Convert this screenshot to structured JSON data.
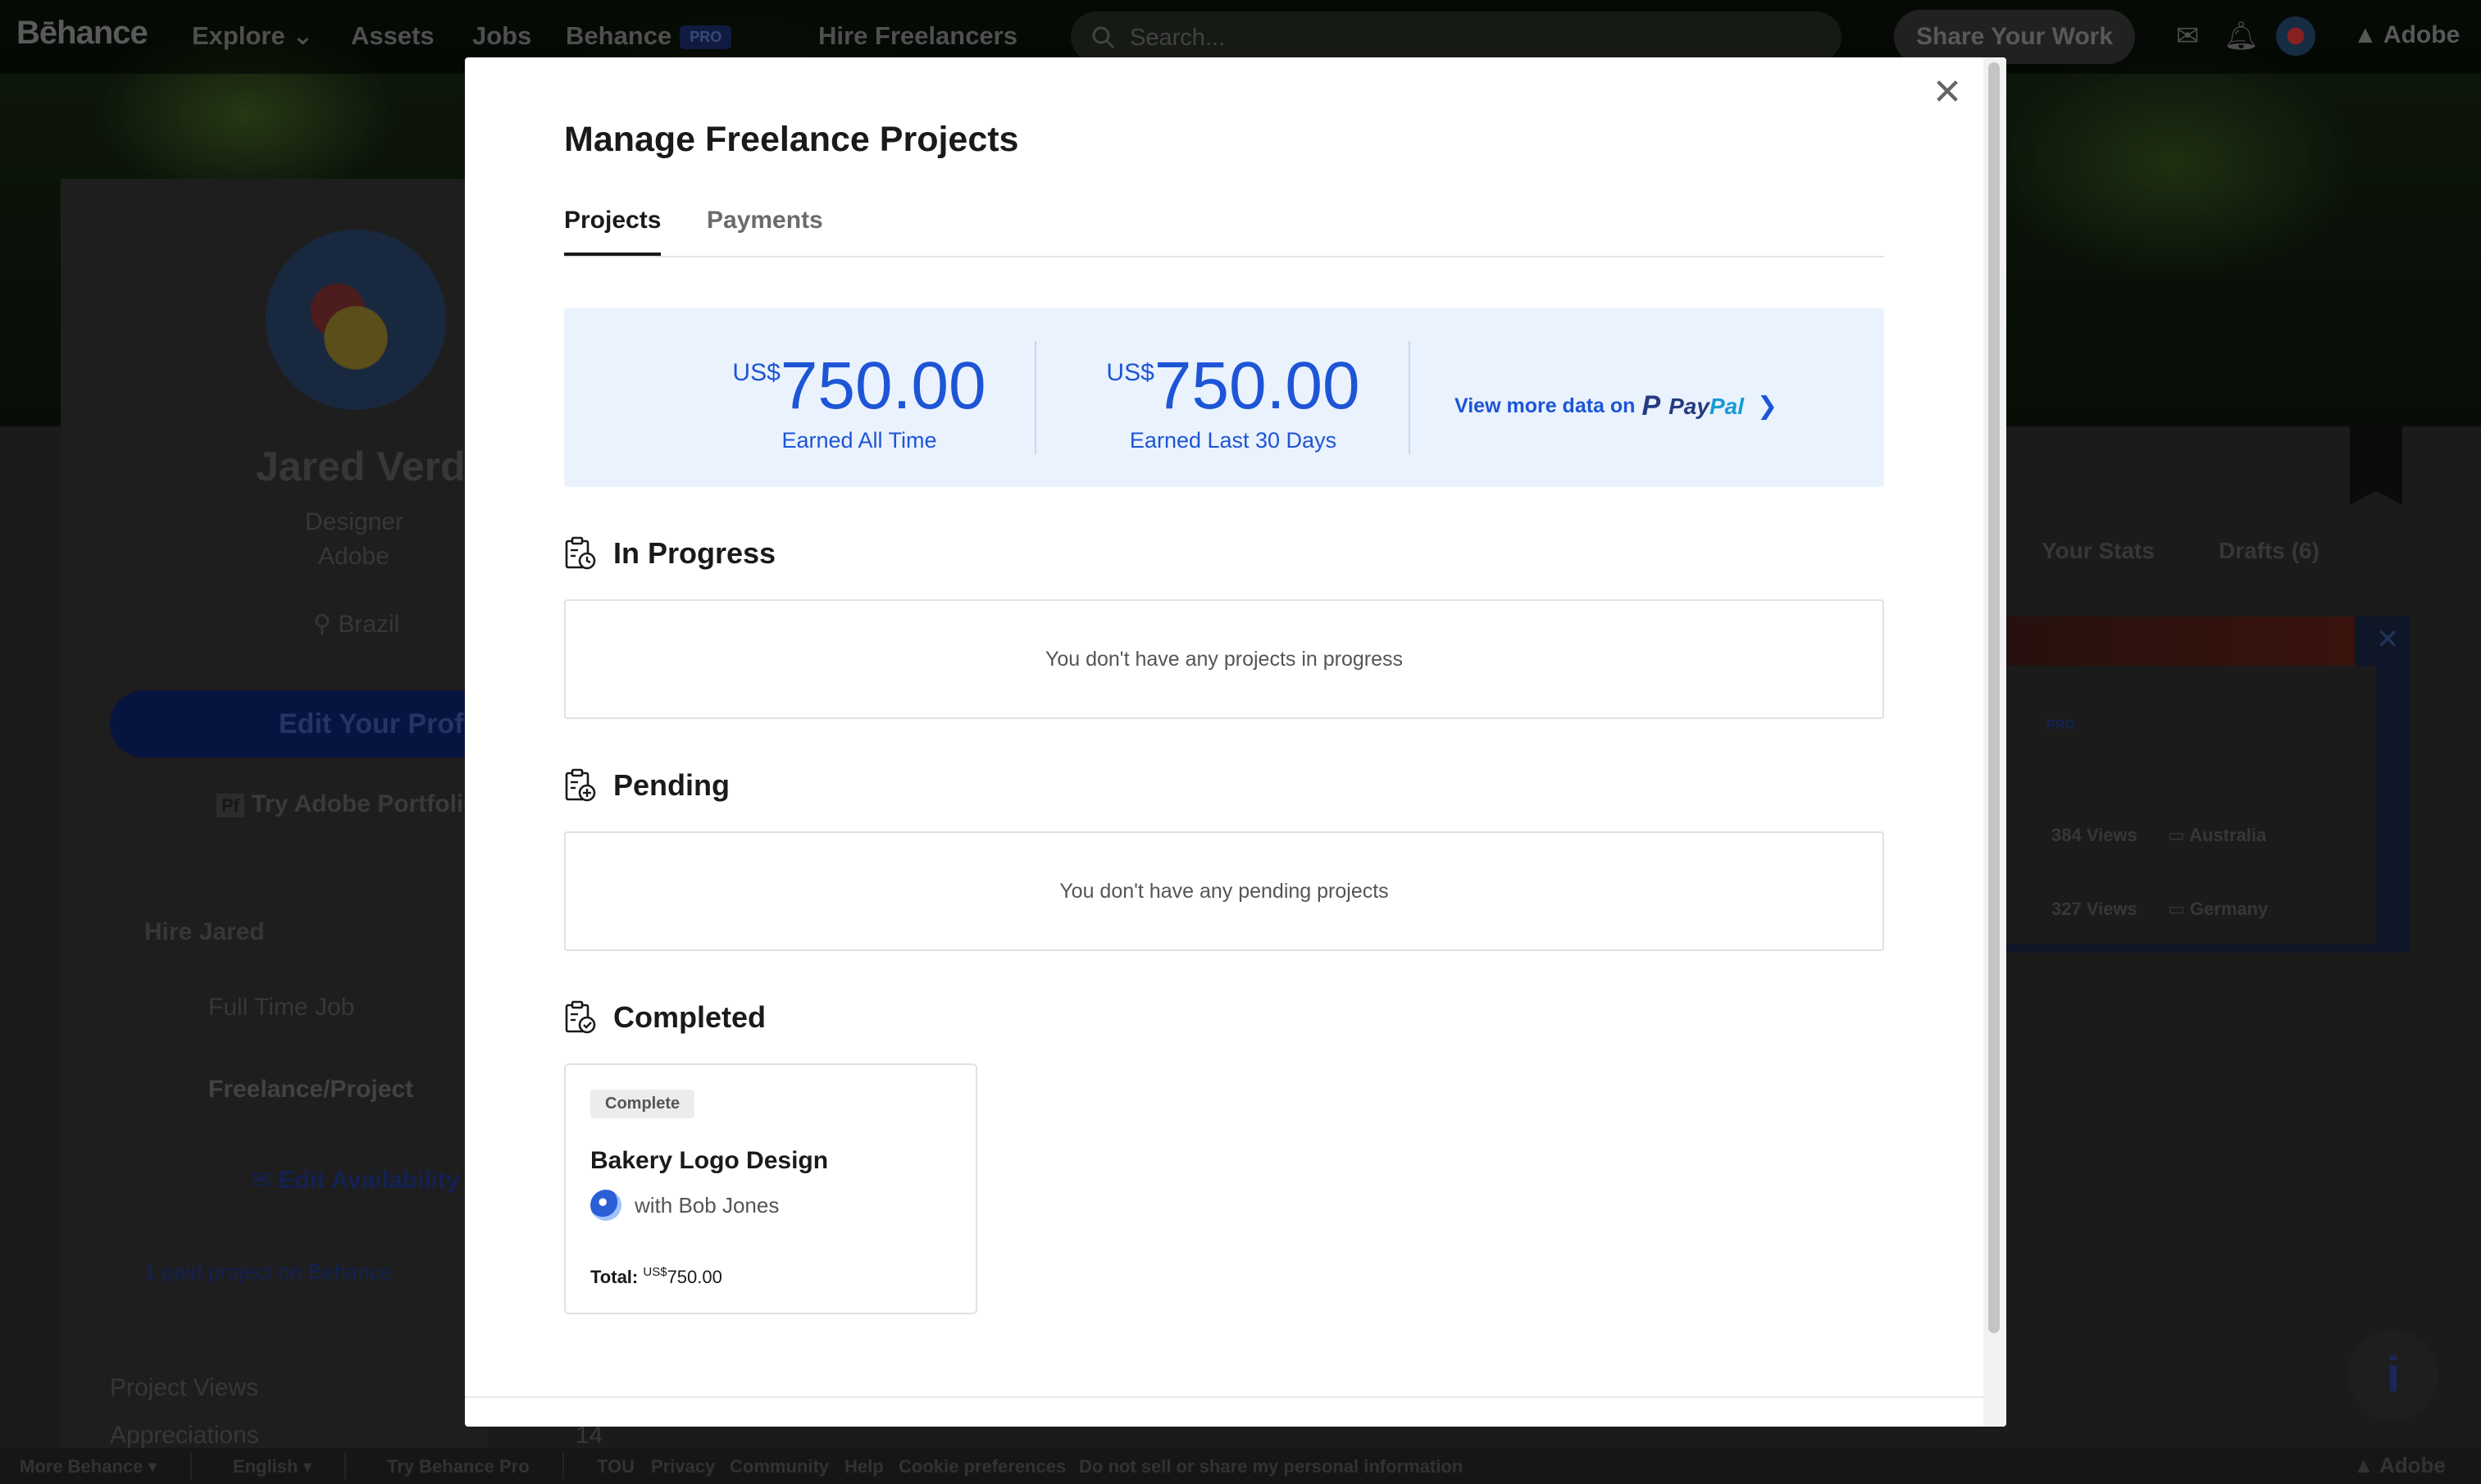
{
  "nav": {
    "logo": "Bēhance",
    "explore": "Explore",
    "assets": "Assets",
    "jobs": "Jobs",
    "behance": "Behance",
    "pro_badge": "PRO",
    "hire": "Hire Freelancers",
    "search_placeholder": "Search...",
    "share": "Share Your Work",
    "adobe": "Adobe"
  },
  "profile": {
    "name": "Jared Verdi",
    "title": "Designer",
    "company": "Adobe",
    "location": "Brazil",
    "edit": "Edit Your Profile",
    "try_portfolio": "Try Adobe Portfolio",
    "hire_heading": "Hire Jared",
    "full_time": "Full Time Job",
    "freelance": "Freelance/Project",
    "edit_availability": "Edit Availability",
    "paid_projects": "1 paid project on Behance",
    "project_views": "Project Views",
    "appreciations": "Appreciations",
    "appreciations_value": "14"
  },
  "right": {
    "your_stats": "Your Stats",
    "drafts": "Drafts (6)",
    "pro": "PRO",
    "views1": "384 Views",
    "country1": "Australia",
    "views2": "327 Views",
    "country2": "Germany"
  },
  "footer": {
    "more": "More Behance ▾",
    "lang": "English ▾",
    "try_pro": "Try Behance Pro",
    "tou": "TOU",
    "privacy": "Privacy",
    "community": "Community",
    "help": "Help",
    "cookie": "Cookie preferences",
    "do_not_sell": "Do not sell or share my personal information",
    "adobe": "Adobe"
  },
  "modal": {
    "title": "Manage Freelance Projects",
    "tabs": [
      {
        "label": "Projects",
        "active": true
      },
      {
        "label": "Payments",
        "active": false
      }
    ],
    "stats": [
      {
        "currency": "US$",
        "value": "750.00",
        "label": "Earned All Time"
      },
      {
        "currency": "US$",
        "value": "750.00",
        "label": "Earned Last 30 Days"
      }
    ],
    "paypal_link": "View more data on",
    "paypal_pay": "Pay",
    "paypal_pal": "Pal",
    "sections": {
      "in_progress": {
        "title": "In Progress",
        "empty": "You don't have any projects in progress"
      },
      "pending": {
        "title": "Pending",
        "empty": "You don't have any pending projects"
      },
      "completed": {
        "title": "Completed"
      }
    },
    "project": {
      "badge": "Complete",
      "name": "Bakery Logo Design",
      "client": "with Bob Jones",
      "total_label": "Total:",
      "total_currency": "US$",
      "total_value": "750.00"
    }
  },
  "colors": {
    "accent": "#1d55d6",
    "stats_bg": "#eaf2fd",
    "paypal_dark": "#253b80",
    "paypal_light": "#169bd7"
  }
}
